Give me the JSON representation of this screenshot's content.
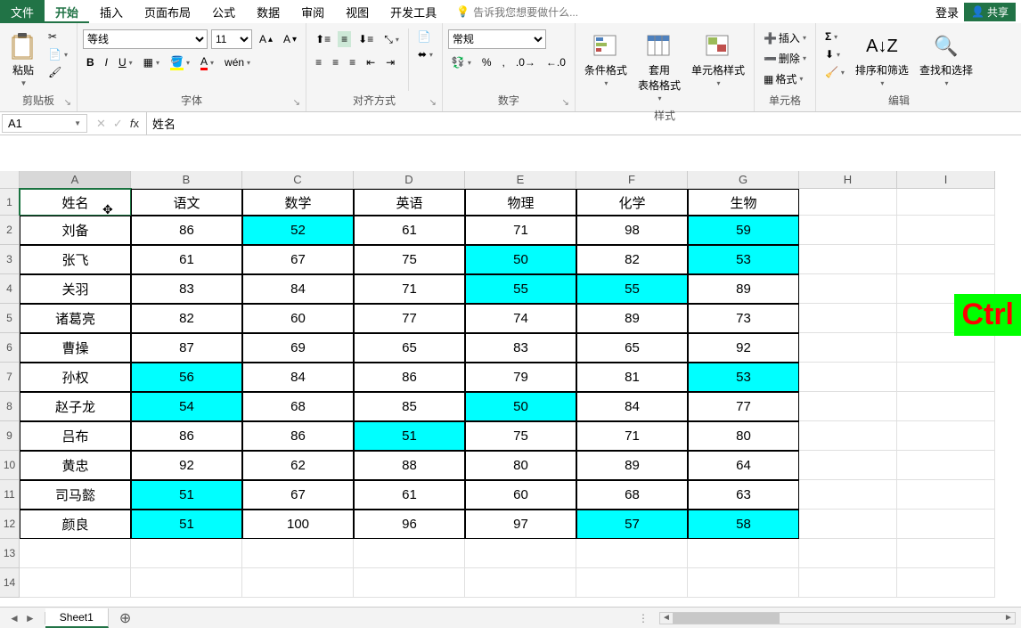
{
  "tabs": {
    "file": "文件",
    "home": "开始",
    "insert": "插入",
    "pagelayout": "页面布局",
    "formulas": "公式",
    "data": "数据",
    "review": "审阅",
    "view": "视图",
    "dev": "开发工具",
    "tellme": "告诉我您想要做什么...",
    "login": "登录",
    "share": "共享"
  },
  "ribbon": {
    "clipboard": {
      "paste": "粘贴",
      "label": "剪贴板"
    },
    "font": {
      "name": "等线",
      "size": "11",
      "label": "字体"
    },
    "align": {
      "label": "对齐方式"
    },
    "number": {
      "format": "常规",
      "label": "数字"
    },
    "styles": {
      "cond": "条件格式",
      "table": "套用\n表格格式",
      "cell": "单元格样式",
      "label": "样式"
    },
    "cells": {
      "insert": "插入",
      "delete": "删除",
      "format": "格式",
      "label": "单元格"
    },
    "editing": {
      "sort": "排序和筛选",
      "find": "查找和选择",
      "label": "编辑"
    }
  },
  "namebox": "A1",
  "formula": "姓名",
  "columns": [
    "A",
    "B",
    "C",
    "D",
    "E",
    "F",
    "G",
    "H",
    "I"
  ],
  "rownums": [
    "1",
    "2",
    "3",
    "4",
    "5",
    "6",
    "7",
    "8",
    "9",
    "10",
    "11",
    "12",
    "13",
    "14"
  ],
  "chart_data": {
    "type": "table",
    "headers": [
      "姓名",
      "语文",
      "数学",
      "英语",
      "物理",
      "化学",
      "生物"
    ],
    "rows": [
      {
        "c": [
          "刘备",
          "86",
          "52",
          "61",
          "71",
          "98",
          "59"
        ],
        "hl": [
          2,
          6
        ]
      },
      {
        "c": [
          "张飞",
          "61",
          "67",
          "75",
          "50",
          "82",
          "53"
        ],
        "hl": [
          4,
          6
        ]
      },
      {
        "c": [
          "关羽",
          "83",
          "84",
          "71",
          "55",
          "55",
          "89"
        ],
        "hl": [
          4,
          5
        ]
      },
      {
        "c": [
          "诸葛亮",
          "82",
          "60",
          "77",
          "74",
          "89",
          "73"
        ],
        "hl": []
      },
      {
        "c": [
          "曹操",
          "87",
          "69",
          "65",
          "83",
          "65",
          "92"
        ],
        "hl": []
      },
      {
        "c": [
          "孙权",
          "56",
          "84",
          "86",
          "79",
          "81",
          "53"
        ],
        "hl": [
          1,
          6
        ]
      },
      {
        "c": [
          "赵子龙",
          "54",
          "68",
          "85",
          "50",
          "84",
          "77"
        ],
        "hl": [
          1,
          4
        ]
      },
      {
        "c": [
          "吕布",
          "86",
          "86",
          "51",
          "75",
          "71",
          "80"
        ],
        "hl": [
          3
        ]
      },
      {
        "c": [
          "黄忠",
          "92",
          "62",
          "88",
          "80",
          "89",
          "64"
        ],
        "hl": []
      },
      {
        "c": [
          "司马懿",
          "51",
          "67",
          "61",
          "60",
          "68",
          "63"
        ],
        "hl": [
          1
        ]
      },
      {
        "c": [
          "颜良",
          "51",
          "100",
          "96",
          "97",
          "57",
          "58"
        ],
        "hl": [
          1,
          5,
          6
        ]
      }
    ]
  },
  "sheet": {
    "name": "Sheet1"
  },
  "badge": "Ctrl"
}
